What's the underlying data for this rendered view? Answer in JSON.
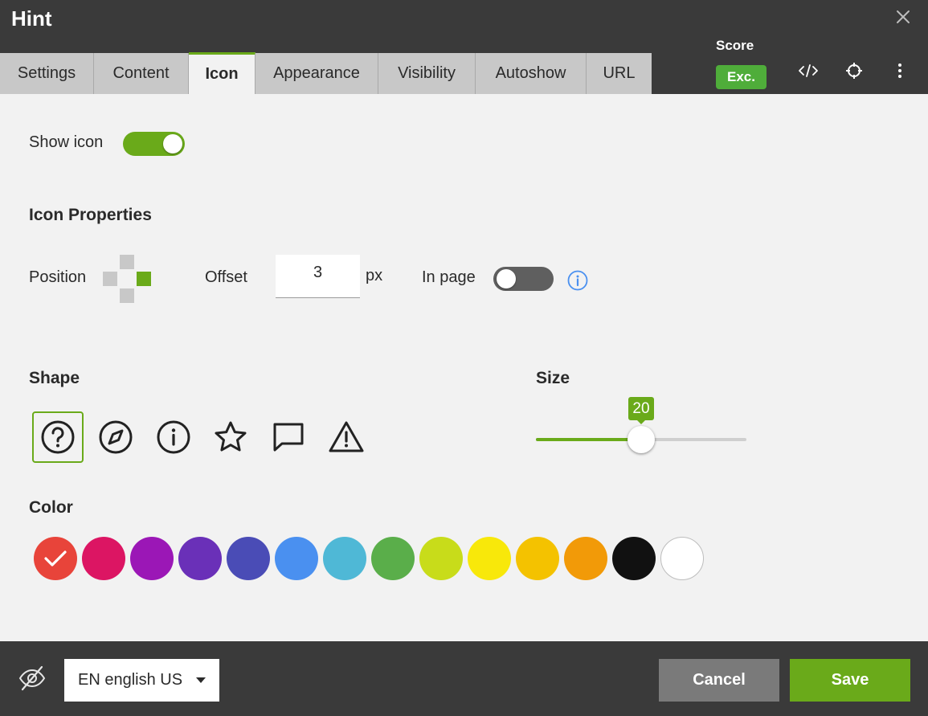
{
  "window": {
    "title": "Hint"
  },
  "tabs": [
    {
      "label": "Settings",
      "active": false
    },
    {
      "label": "Content",
      "active": false
    },
    {
      "label": "Icon",
      "active": true
    },
    {
      "label": "Appearance",
      "active": false
    },
    {
      "label": "Visibility",
      "active": false
    },
    {
      "label": "Autoshow",
      "active": false
    },
    {
      "label": "URL",
      "active": false
    }
  ],
  "score": {
    "label": "Score",
    "badge": "Exc.",
    "badge_color": "#4fad3a"
  },
  "header_icons": [
    "code-icon",
    "crosshair-icon",
    "more-vertical-icon",
    "close-icon"
  ],
  "show_icon": {
    "label": "Show icon",
    "checked": true
  },
  "icon_properties": {
    "heading": "Icon Properties",
    "position_label": "Position",
    "position_selected": "right",
    "offset_label": "Offset",
    "offset_value": "3",
    "offset_unit": "px",
    "in_page_label": "In page",
    "in_page_checked": false
  },
  "shape": {
    "heading": "Shape",
    "options": [
      "question-circle-icon",
      "compass-icon",
      "info-circle-icon",
      "star-icon",
      "speech-bubble-icon",
      "warning-triangle-icon"
    ],
    "selected": "question-circle-icon"
  },
  "size": {
    "heading": "Size",
    "value": 20,
    "value_text": "20",
    "min": 0,
    "max": 40
  },
  "color": {
    "heading": "Color",
    "swatches": [
      "#e8443a",
      "#dc1563",
      "#9b17b6",
      "#6a30b8",
      "#4a4cb6",
      "#4a90f0",
      "#4fb8d6",
      "#5aae4a",
      "#c8dc1a",
      "#f8e80a",
      "#f4c200",
      "#f29a08",
      "#111111",
      "#ffffff"
    ],
    "selected_index": 0
  },
  "footer": {
    "language": "EN english US",
    "cancel_label": "Cancel",
    "save_label": "Save"
  },
  "accent_color": "#6aaa1a"
}
